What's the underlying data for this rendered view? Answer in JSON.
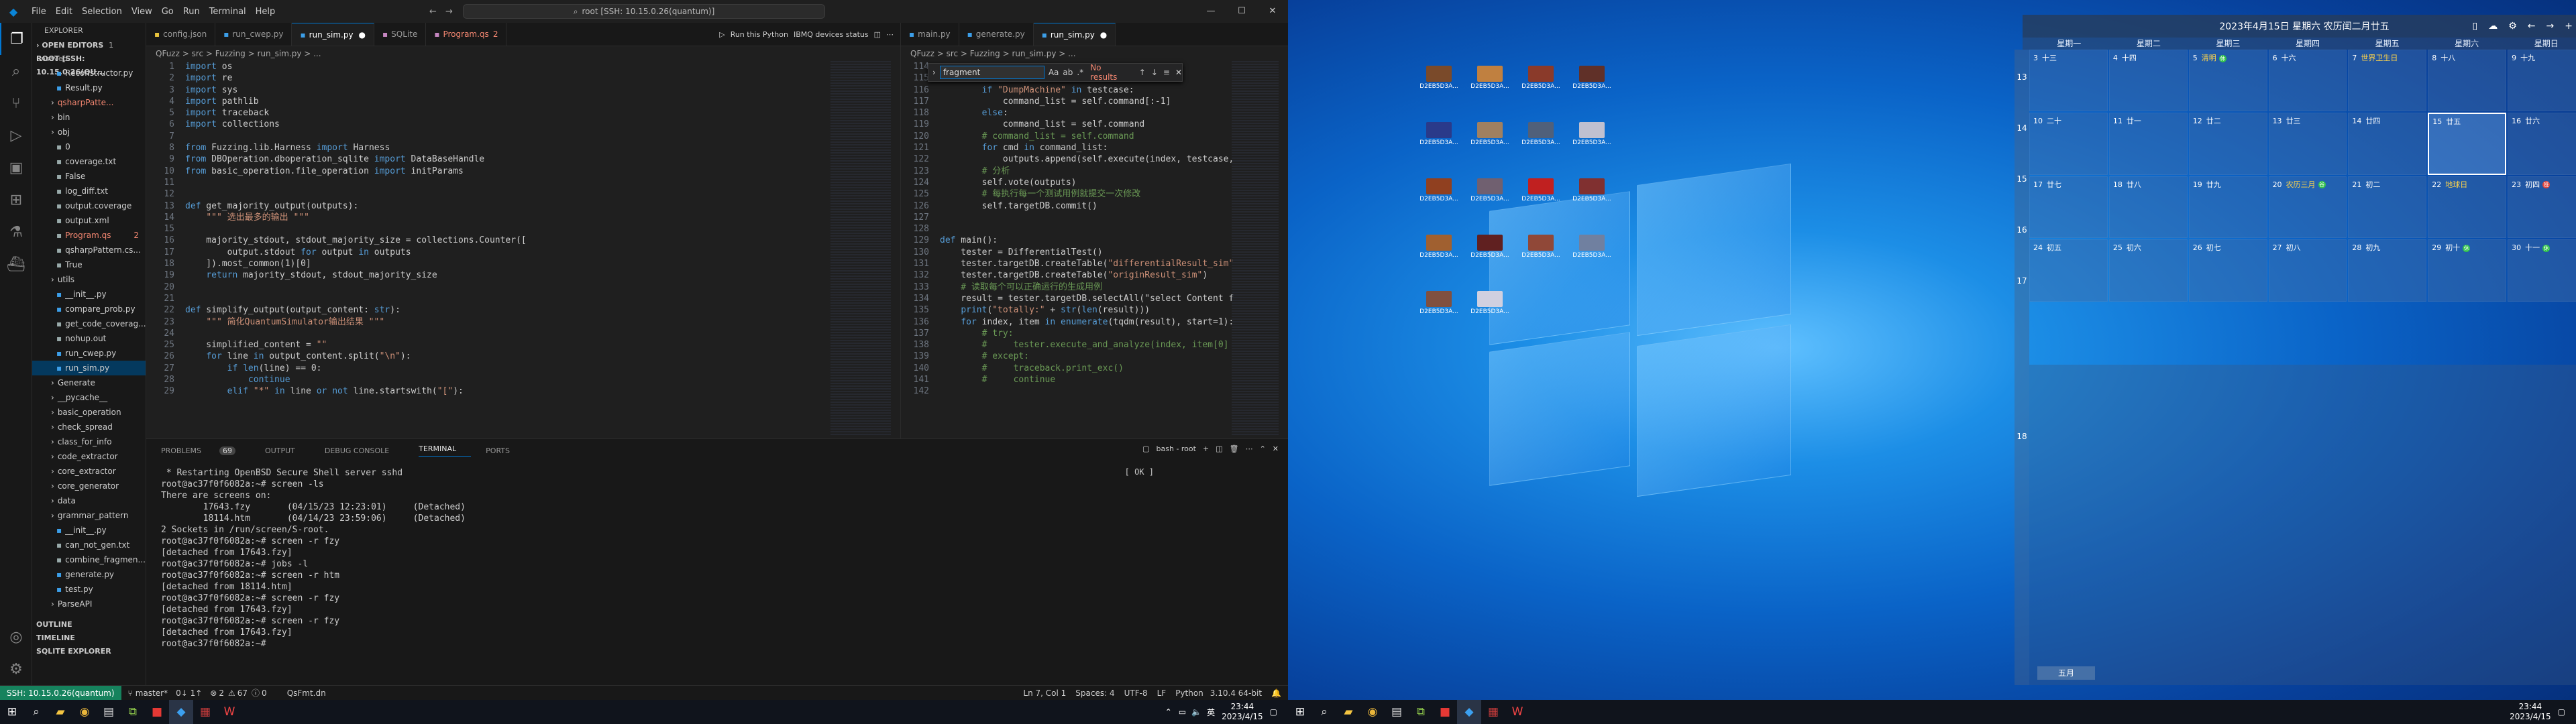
{
  "left": {
    "titlebar": {
      "menu": [
        "File",
        "Edit",
        "Selection",
        "View",
        "Go",
        "Run",
        "Terminal",
        "Help"
      ],
      "search": "root [SSH: 10.15.0.26(quantum)]"
    },
    "explorer": {
      "title": "EXPLORER",
      "open_editors": "OPEN EDITORS",
      "open_editors_badge": "1 unsaved",
      "root": "ROOT [SSH: 10.15.0.26(QU...",
      "files": [
        "Reconstructor.py",
        "Result.py",
        "qsharpPatte...",
        "bin",
        "obj",
        "0",
        "coverage.txt",
        "False",
        "log_diff.txt",
        "output.coverage",
        "output.xml",
        "Program.qs",
        "qsharpPattern.cs...",
        "True",
        "utils",
        "__init__.py",
        "compare_prob.py",
        "get_code_coverag...",
        "nohup.out",
        "run_cwep.py",
        "run_sim.py",
        "Generate",
        "__pycache__",
        "basic_operation",
        "check_spread",
        "class_for_info",
        "code_extractor",
        "core_extractor",
        "core_generator",
        "data",
        "grammar_pattern",
        "__init__.py",
        "can_not_gen.txt",
        "combine_fragmen...",
        "generate.py",
        "test.py",
        "ParseAPI"
      ],
      "program_badge": "2",
      "outline": "OUTLINE",
      "timeline": "TIMELINE",
      "sqlite": "SQLITE EXPLORER"
    },
    "group1": {
      "tabs": [
        "config.json",
        "run_cwep.py",
        "run_sim.py",
        "SQLite",
        "Program.qs"
      ],
      "tab_program_badge": "2",
      "actions": {
        "run_label": "Run this Python",
        "devices": "IBMQ devices status"
      },
      "breadcrumb": "QFuzz > src > Fuzzing > run_sim.py > ...",
      "line_numbers": [
        "1",
        "2",
        "3",
        "4",
        "5",
        "6",
        "7",
        "8",
        "9",
        "10",
        "11",
        "12",
        "13",
        "14",
        "15",
        "16",
        "17",
        "18",
        "19",
        "20",
        "21",
        "22",
        "23",
        "24",
        "25",
        "26",
        "27",
        "28",
        "29"
      ],
      "lines": [
        "import os",
        "import re",
        "import sys",
        "import pathlib",
        "import traceback",
        "import collections",
        "",
        "from Fuzzing.lib.Harness import Harness",
        "from DBOperation.dboperation_sqlite import DataBaseHandle",
        "from basic_operation.file_operation import initParams",
        "",
        "",
        "def get_majority_output(outputs):",
        "    \"\"\" 选出最多的输出 \"\"\"",
        "",
        "    majority_stdout, stdout_majority_size = collections.Counter([",
        "        output.stdout for output in outputs",
        "    ]).most_common(1)[0]",
        "    return majority_stdout, stdout_majority_size",
        "",
        "",
        "def simplify_output(output_content: str):",
        "    \"\"\" 简化QuantumSimulator输出结果 \"\"\"",
        "",
        "    simplified_content = \"\"",
        "    for line in output_content.split(\"\\n\"):",
        "        if len(line) == 0:",
        "            continue",
        "        elif \"*\" in line or not line.startswith(\"[\"):"
      ]
    },
    "group2": {
      "tabs": [
        "main.py",
        "generate.py",
        "run_sim.py"
      ],
      "breadcrumb": "QFuzz > src > Fuzzing > run_sim.py > ...",
      "find": {
        "value": "fragment",
        "result": "No results"
      },
      "line_numbers": [
        "114",
        "115",
        "116",
        "117",
        "118",
        "119",
        "120",
        "121",
        "122",
        "123",
        "124",
        "125",
        "126",
        "127",
        "128",
        "129",
        "130",
        "131",
        "132",
        "133",
        "134",
        "135",
        "136",
        "137",
        "138",
        "139",
        "140",
        "141",
        "142"
      ],
      "lines": [
        "",
        "        # 执行",
        "        if \"DumpMachine\" in testcase:",
        "            command_list = self.command[:-1]",
        "        else:",
        "            command_list = self.command",
        "        # command_list = self.command",
        "        for cmd in command_list:",
        "            outputs.append(self.execute(index, testcase,",
        "        # 分析",
        "        self.vote(outputs)",
        "        # 每执行每一个测试用例就提交一次修改",
        "        self.targetDB.commit()",
        "",
        "",
        "def main():",
        "    tester = DifferentialTest()",
        "    tester.targetDB.createTable(\"differentialResult_sim\"",
        "    tester.targetDB.createTable(\"originResult_sim\")",
        "    # 读取每个可以正确运行的生成用例",
        "    result = tester.targetDB.selectAll(\"select Content f",
        "    print(\"totally:\" + str(len(result)))",
        "    for index, item in enumerate(tqdm(result), start=1):",
        "        # try:",
        "        #     tester.execute_and_analyze(index, item[0]",
        "        # except:",
        "        #     traceback.print_exc()",
        "        #     continue",
        ""
      ]
    },
    "panel": {
      "tabs": [
        "PROBLEMS",
        "OUTPUT",
        "DEBUG CONSOLE",
        "TERMINAL",
        "PORTS"
      ],
      "problems_count": "69",
      "shell": "bash - root",
      "terminal_badge": "[ OK ]",
      "terminal": [
        " * Restarting OpenBSD Secure Shell server sshd",
        "root@ac37f0f6082a:~# screen -ls",
        "There are screens on:",
        "        17643.fzy       (04/15/23 12:23:01)     (Detached)",
        "        18114.htm       (04/14/23 23:59:06)     (Detached)",
        "2 Sockets in /run/screen/S-root.",
        "root@ac37f0f6082a:~# screen -r fzy",
        "[detached from 17643.fzy]",
        "root@ac37f0f6082a:~# jobs -l",
        "root@ac37f0f6082a:~# screen -r htm",
        "[detached from 18114.htm]",
        "root@ac37f0f6082a:~# screen -r fzy",
        "[detached from 17643.fzy]",
        "root@ac37f0f6082a:~# screen -r fzy",
        "[detached from 17643.fzy]",
        "root@ac37f0f6082a:~# "
      ]
    },
    "statusbar": {
      "remote": "SSH: 10.15.0.26(quantum)",
      "branch": "master*",
      "sync": "0↓ 1↑",
      "errors": "2",
      "warnings": "67",
      "info": "0",
      "qsfmt": "QsFmt.dn",
      "position": "Ln 7, Col 1",
      "spaces": "Spaces: 4",
      "encoding": "UTF-8",
      "eol": "LF",
      "language": "Python",
      "version": "3.10.4 64-bit"
    },
    "clock": {
      "time": "23:44",
      "date": "2023/4/15"
    }
  },
  "right": {
    "calendar": {
      "header": "2023年4月15日 星期六 农历闰二月廿五",
      "weekdays": [
        "星期一",
        "星期二",
        "星期三",
        "星期四",
        "星期五",
        "星期六",
        "星期日"
      ],
      "week_numbers": [
        "13",
        "14",
        "15",
        "16",
        "17",
        "18"
      ],
      "days": [
        {
          "d": "3",
          "l": "十三"
        },
        {
          "d": "4",
          "l": "十四"
        },
        {
          "d": "5",
          "l": "清明",
          "hl": true,
          "badge": "休"
        },
        {
          "d": "6",
          "l": "十六"
        },
        {
          "d": "7",
          "l": "世界卫生日",
          "hl": true
        },
        {
          "d": "8",
          "l": "十八"
        },
        {
          "d": "9",
          "l": "十九"
        },
        {
          "d": "10",
          "l": "二十"
        },
        {
          "d": "11",
          "l": "廿一"
        },
        {
          "d": "12",
          "l": "廿二"
        },
        {
          "d": "13",
          "l": "廿三"
        },
        {
          "d": "14",
          "l": "廿四"
        },
        {
          "d": "15",
          "l": "廿五",
          "today": true
        },
        {
          "d": "16",
          "l": "廿六"
        },
        {
          "d": "17",
          "l": "廿七"
        },
        {
          "d": "18",
          "l": "廿八"
        },
        {
          "d": "19",
          "l": "廿九"
        },
        {
          "d": "20",
          "l": "农历三月",
          "hl": true,
          "badge": "谷"
        },
        {
          "d": "21",
          "l": "初二"
        },
        {
          "d": "22",
          "l": "地球日",
          "hl": true
        },
        {
          "d": "23",
          "l": "初四",
          "badge": "班",
          "red": true
        },
        {
          "d": "24",
          "l": "初五"
        },
        {
          "d": "25",
          "l": "初六"
        },
        {
          "d": "26",
          "l": "初七"
        },
        {
          "d": "27",
          "l": "初八"
        },
        {
          "d": "28",
          "l": "初九"
        },
        {
          "d": "29",
          "l": "初十",
          "badge": "休"
        },
        {
          "d": "30",
          "l": "十一",
          "badge": "休"
        }
      ],
      "month_button": "五月"
    },
    "desktop_icons": [
      "D2EB5D3A...",
      "D2EB5D3A...",
      "D2EB5D3A...",
      "D2EB5D3A...",
      "D2EB5D3A...",
      "D2EB5D3A...",
      "D2EB5D3A...",
      "D2EB5D3A...",
      "D2EB5D3A...",
      "D2EB5D3A...",
      "D2EB5D3A...",
      "D2EB5D3A...",
      "D2EB5D3A...",
      "D2EB5D3A...",
      "D2EB5D3A...",
      "D2EB5D3A...",
      "D2EB5D3A...",
      "D2EB5D3A..."
    ],
    "clock": {
      "time": "23:44",
      "date": "2023/4/15"
    }
  },
  "colors": {
    "accent": "#0078d4",
    "remote": "#16825d",
    "keyword": "#569cd6",
    "string": "#ce9178",
    "comment": "#6a9955",
    "func": "#dcdcaa"
  }
}
